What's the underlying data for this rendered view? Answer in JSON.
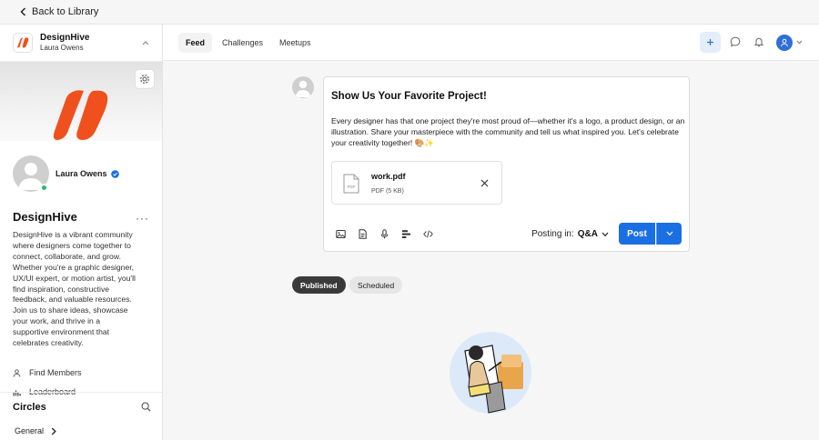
{
  "topbar": {
    "back_label": "Back to Library"
  },
  "community": {
    "name": "DesignHive",
    "owner": "Laura Owens",
    "title": "DesignHive",
    "description": "DesignHive is a vibrant community where designers come together to connect, collaborate, and grow. Whether you're a graphic designer, UX/UI expert, or motion artist, you'll find inspiration, constructive feedback, and valuable resources. Join us to share ideas, showcase your work, and thrive in a supportive environment that celebrates creativity.",
    "brand_color": "#f0501e"
  },
  "profile": {
    "name": "Laura Owens",
    "verified_icon": "verified-badge-icon",
    "status_color": "#2bb673"
  },
  "sidebar": {
    "links": [
      {
        "label": "Find Members",
        "icon": "person-icon"
      },
      {
        "label": "Leaderboard",
        "icon": "bar-chart-icon"
      }
    ],
    "circles_title": "Circles",
    "circles_items": [
      {
        "label": "General"
      }
    ]
  },
  "header": {
    "tabs": [
      {
        "label": "Feed",
        "active": true
      },
      {
        "label": "Challenges",
        "active": false
      },
      {
        "label": "Meetups",
        "active": false
      }
    ]
  },
  "composer": {
    "title": "Show Us Your Favorite Project!",
    "body": "Every designer has that one project they're most proud of—whether it's a logo, a product design, or an illustration. Share your masterpiece with the community and tell us what inspired you. Let's celebrate your creativity together! 🎨✨",
    "attachment": {
      "name": "work.pdf",
      "meta": "PDF (5 KB)",
      "icon_label": "PDF"
    },
    "posting_in_label": "Posting in:",
    "posting_in_value": "Q&A",
    "post_label": "Post",
    "accent": "#1a6fe3"
  },
  "filters": {
    "published": "Published",
    "scheduled": "Scheduled"
  }
}
